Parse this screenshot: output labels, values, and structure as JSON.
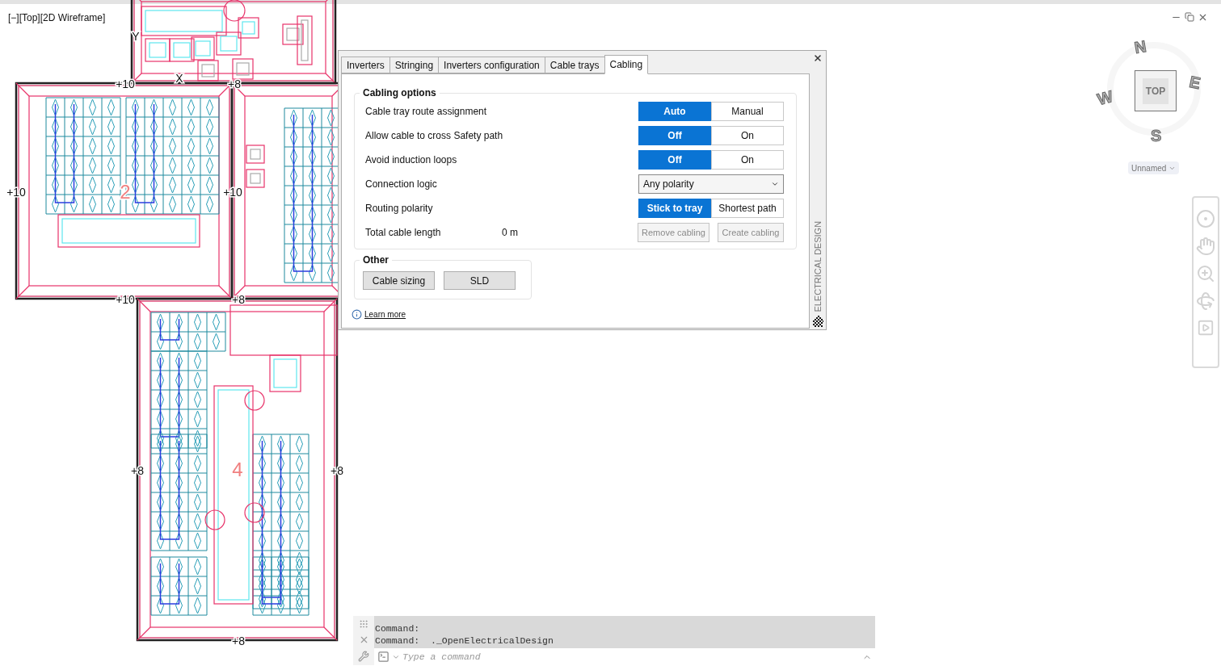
{
  "viewport_label": "[−][Top][2D Wireframe]",
  "drawing": {
    "labels": [
      {
        "kind": "axis",
        "text": "Y"
      },
      {
        "kind": "axis",
        "text": "X"
      },
      {
        "kind": "elevation",
        "text": "+10"
      },
      {
        "kind": "elevation",
        "text": "+8"
      },
      {
        "kind": "elevation",
        "text": "+10"
      },
      {
        "kind": "roof",
        "text": "2"
      },
      {
        "kind": "elevation",
        "text": "+10"
      },
      {
        "kind": "elevation",
        "text": "+10"
      },
      {
        "kind": "elevation",
        "text": "+8"
      },
      {
        "kind": "elevation",
        "text": "+8"
      },
      {
        "kind": "roof",
        "text": "4"
      },
      {
        "kind": "elevation",
        "text": "+8"
      },
      {
        "kind": "elevation",
        "text": "+8"
      }
    ]
  },
  "viewcube": {
    "face": "TOP",
    "compass": [
      "N",
      "E",
      "S",
      "W"
    ],
    "view_menu": "Unnamed"
  },
  "panel": {
    "tabs": [
      {
        "label": "Inverters",
        "selected": false
      },
      {
        "label": "Stringing",
        "selected": false
      },
      {
        "label": "Inverters configuration",
        "selected": false
      },
      {
        "label": "Cable trays",
        "selected": false
      },
      {
        "label": "Cabling",
        "selected": true
      }
    ],
    "side_title": "ELECTRICAL DESIGN",
    "cabling_options": {
      "title": "Cabling options",
      "rows": [
        {
          "kind": "toggle",
          "label": "Cable tray route assignment",
          "options": [
            {
              "label": "Auto",
              "selected": true
            },
            {
              "label": "Manual",
              "selected": false
            }
          ]
        },
        {
          "kind": "toggle",
          "label": "Allow cable to cross Safety path",
          "options": [
            {
              "label": "Off",
              "selected": true
            },
            {
              "label": "On",
              "selected": false
            }
          ]
        },
        {
          "kind": "toggle",
          "label": "Avoid induction loops",
          "options": [
            {
              "label": "Off",
              "selected": true
            },
            {
              "label": "On",
              "selected": false
            }
          ]
        },
        {
          "kind": "dropdown",
          "label": "Connection logic",
          "value": "Any polarity"
        },
        {
          "kind": "toggle",
          "label": "Routing polarity",
          "options": [
            {
              "label": "Stick to tray",
              "selected": true
            },
            {
              "label": "Shortest path",
              "selected": false
            }
          ]
        },
        {
          "kind": "actions",
          "label": "Total cable length",
          "value": "0 m",
          "buttons": [
            {
              "label": "Remove cabling",
              "disabled": true
            },
            {
              "label": "Create cabling",
              "disabled": true
            }
          ]
        }
      ]
    },
    "other": {
      "title": "Other",
      "buttons": [
        "Cable sizing",
        "SLD"
      ]
    },
    "learn_more": "Learn more"
  },
  "command_line": {
    "history": [
      "Command:",
      "Command:  ._OpenElectricalDesign"
    ],
    "placeholder": "Type a command"
  }
}
